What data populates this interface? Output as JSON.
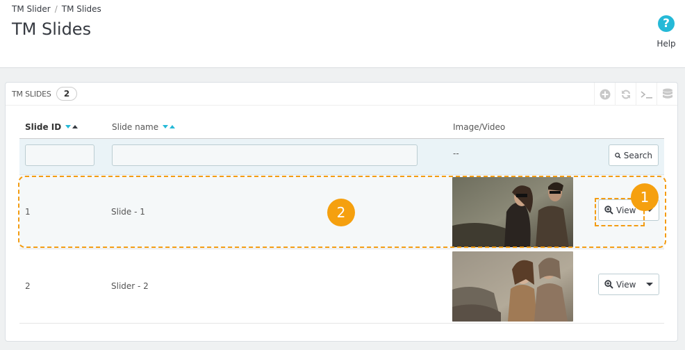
{
  "breadcrumb": {
    "parent": "TM Slider",
    "separator": "/",
    "current": "TM Slides"
  },
  "page": {
    "title": "TM Slides"
  },
  "help": {
    "label": "Help",
    "glyph": "?"
  },
  "panel": {
    "title": "TM SLIDES",
    "count": "2",
    "tools": [
      "add-icon",
      "refresh-icon",
      "terminal-icon",
      "database-icon"
    ]
  },
  "columns": {
    "id": "Slide ID",
    "name": "Slide name",
    "image": "Image/Video"
  },
  "filters": {
    "id_value": "",
    "name_value": "",
    "image_placeholder": "--",
    "search_label": "Search"
  },
  "rows": [
    {
      "id": "1",
      "name": "Slide - 1",
      "view_label": "View"
    },
    {
      "id": "2",
      "name": "Slider - 2",
      "view_label": "View"
    }
  ],
  "markers": {
    "view_button": "1",
    "table_row": "2"
  },
  "colors": {
    "accent": "#25b9d7",
    "marker": "#f5a00f",
    "highlight_border": "#f39c12"
  }
}
